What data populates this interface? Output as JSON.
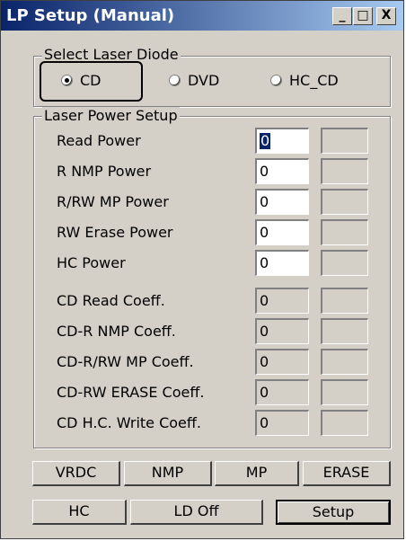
{
  "window": {
    "title": "LP Setup (Manual)",
    "controls": {
      "minimize": "_",
      "maximize": "□",
      "close": "X"
    }
  },
  "laser_diode": {
    "group_label": "Select Laser Diode",
    "options": [
      {
        "label": "CD",
        "checked": true
      },
      {
        "label": "DVD",
        "checked": false
      },
      {
        "label": "HC_CD",
        "checked": false
      }
    ]
  },
  "laser_power": {
    "group_label": "Laser Power Setup",
    "rows": [
      {
        "label": "Read Power",
        "value": "0",
        "state": "active-focused"
      },
      {
        "label": "R NMP Power",
        "value": "0",
        "state": "active"
      },
      {
        "label": "R/RW MP Power",
        "value": "0",
        "state": "active"
      },
      {
        "label": "RW Erase Power",
        "value": "0",
        "state": "active"
      },
      {
        "label": "HC Power",
        "value": "0",
        "state": "active"
      },
      {
        "label": "CD Read Coeff.",
        "value": "0",
        "state": "disabled"
      },
      {
        "label": "CD-R NMP Coeff.",
        "value": "0",
        "state": "disabled"
      },
      {
        "label": "CD-R/RW MP Coeff.",
        "value": "0",
        "state": "disabled"
      },
      {
        "label": "CD-RW ERASE Coeff.",
        "value": "0",
        "state": "disabled"
      },
      {
        "label": "CD H.C. Write Coeff.",
        "value": "0",
        "state": "disabled"
      }
    ]
  },
  "buttons": {
    "vrdc": "VRDC",
    "nmp": "NMP",
    "mp": "MP",
    "erase": "ERASE",
    "hc": "HC",
    "ld_off": "LD Off",
    "setup": "Setup"
  }
}
